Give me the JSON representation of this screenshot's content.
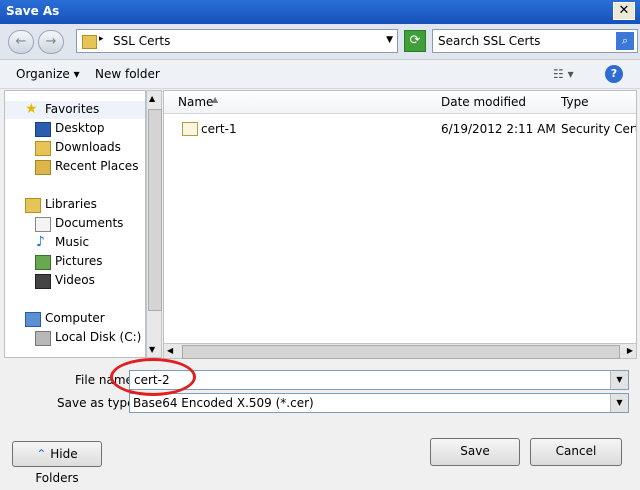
{
  "window": {
    "title": "Save As",
    "close_glyph": "✕"
  },
  "nav": {
    "back_glyph": "←",
    "forward_glyph": "→",
    "address": "SSL Certs",
    "search_placeholder": "Search SSL Certs"
  },
  "toolbar": {
    "organize": "Organize ▾",
    "new_folder": "New folder",
    "views": "☷ ▾",
    "help": "?"
  },
  "sidebar": {
    "items": [
      {
        "label": "Favorites",
        "icon": "star-icon"
      },
      {
        "label": "Desktop",
        "icon": "desktop-icon"
      },
      {
        "label": "Downloads",
        "icon": "downloads-icon"
      },
      {
        "label": "Recent Places",
        "icon": "recent-places-icon"
      },
      {
        "label": "Libraries",
        "icon": "libraries-icon"
      },
      {
        "label": "Documents",
        "icon": "documents-icon"
      },
      {
        "label": "Music",
        "icon": "music-icon"
      },
      {
        "label": "Pictures",
        "icon": "pictures-icon"
      },
      {
        "label": "Videos",
        "icon": "videos-icon"
      },
      {
        "label": "Computer",
        "icon": "computer-icon"
      },
      {
        "label": "Local Disk (C:)",
        "icon": "disk-icon"
      }
    ]
  },
  "files": {
    "columns": [
      "Name",
      "Date modified",
      "Type"
    ],
    "rows": [
      {
        "name": "cert-1",
        "date": "6/19/2012 2:11 AM",
        "type": "Security Certificate"
      }
    ]
  },
  "form": {
    "file_name_label": "File name:",
    "file_name_value": "cert-2",
    "save_as_type_label": "Save as type:",
    "save_as_type_value": "Base64 Encoded X.509 (*.cer)"
  },
  "buttons": {
    "hide_folders": "Hide Folders",
    "save": "Save",
    "cancel": "Cancel"
  },
  "colors": {
    "title_bar": "#1f5fc7",
    "highlight_circle": "#e02020"
  }
}
